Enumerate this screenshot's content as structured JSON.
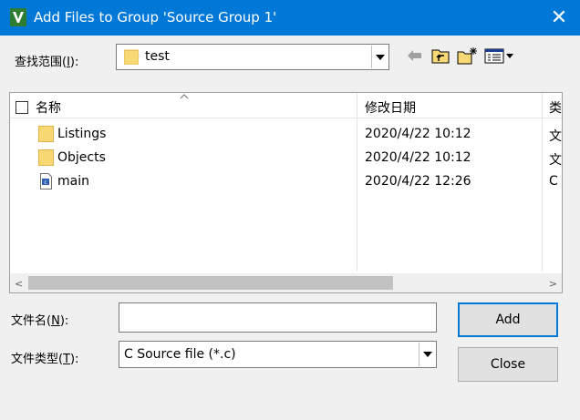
{
  "window": {
    "title": "Add Files to Group 'Source Group 1'",
    "close_glyph": "✕"
  },
  "lookin": {
    "label_pre": "查找范围(",
    "label_key": "I",
    "label_post": "):",
    "value": "test"
  },
  "toolbar": {
    "back_icon": "back-arrow-icon",
    "up_icon": "up-folder-icon",
    "new_folder_icon": "new-folder-icon",
    "view_icon": "view-menu-icon"
  },
  "list": {
    "columns": {
      "name": "名称",
      "date": "修改日期",
      "type": "类型"
    },
    "rows": [
      {
        "name": "Listings",
        "date": "2020/4/22 10:12",
        "type": "文件夹",
        "icon": "folder-icon"
      },
      {
        "name": "Objects",
        "date": "2020/4/22 10:12",
        "type": "文件夹",
        "icon": "folder-icon"
      },
      {
        "name": "main",
        "date": "2020/4/22 12:26",
        "type": "C Source file",
        "icon": "c-file-icon"
      }
    ],
    "scroll_left": "<",
    "scroll_right": ">"
  },
  "filename": {
    "label_pre": "文件名(",
    "label_key": "N",
    "label_post": "):",
    "value": "",
    "placeholder": ""
  },
  "filetype": {
    "label_pre": "文件类型(",
    "label_key": "T",
    "label_post": "):",
    "value": "C Source file (*.c)"
  },
  "buttons": {
    "add": "Add",
    "close": "Close"
  },
  "colors": {
    "titlebar": "#0078d7",
    "folder": "#f8d775",
    "accent": "#0078d7"
  }
}
